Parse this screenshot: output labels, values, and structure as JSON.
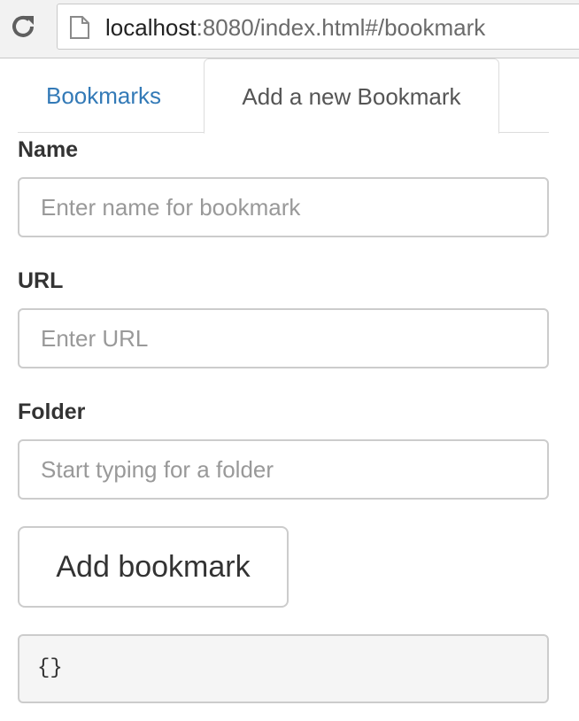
{
  "browser": {
    "url_host": "localhost",
    "url_rest": ":8080/index.html#/bookmark"
  },
  "tabs": [
    {
      "label": "Bookmarks",
      "active": false
    },
    {
      "label": "Add a new Bookmark",
      "active": true
    }
  ],
  "form": {
    "name": {
      "label": "Name",
      "placeholder": "Enter name for bookmark",
      "value": ""
    },
    "url": {
      "label": "URL",
      "placeholder": "Enter URL",
      "value": ""
    },
    "folder": {
      "label": "Folder",
      "placeholder": "Start typing for a folder",
      "value": ""
    },
    "submit_label": "Add bookmark"
  },
  "output": "{}",
  "colors": {
    "link": "#337ab7",
    "border": "#cccccc",
    "toolbar": "#f2f2f2"
  }
}
